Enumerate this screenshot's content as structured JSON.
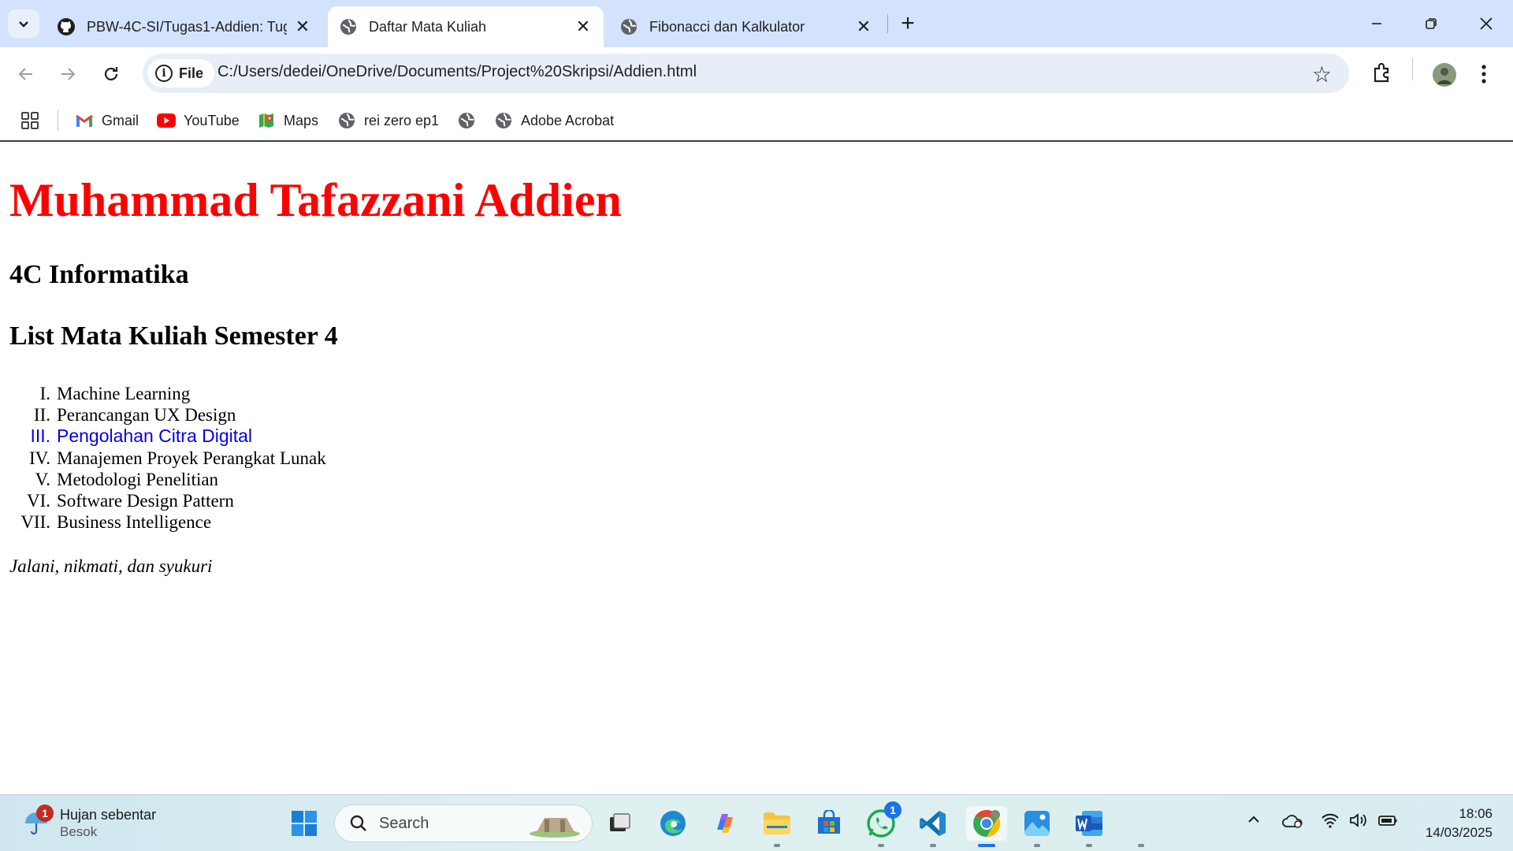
{
  "browser": {
    "tabs": [
      {
        "title": "PBW-4C-SI/Tugas1-Addien: Tug",
        "favicon": "github-icon",
        "active": false
      },
      {
        "title": "Daftar Mata Kuliah",
        "favicon": "globe-icon",
        "active": true
      },
      {
        "title": "Fibonacci dan Kalkulator",
        "favicon": "globe-icon",
        "active": false
      }
    ],
    "address": {
      "chip_label": "File",
      "url": "C:/Users/dedei/OneDrive/Documents/Project%20Skripsi/Addien.html"
    },
    "bookmarks": [
      {
        "label": "Gmail",
        "icon": "gmail-icon"
      },
      {
        "label": "YouTube",
        "icon": "youtube-icon"
      },
      {
        "label": "Maps",
        "icon": "maps-icon"
      },
      {
        "label": "rei zero ep1",
        "icon": "globe-icon"
      },
      {
        "label": "",
        "icon": "globe-icon"
      },
      {
        "label": "Adobe Acrobat",
        "icon": "globe-icon"
      }
    ]
  },
  "page": {
    "name": "Muhammad Tafazzani Addien",
    "class": "4C Informatika",
    "list_heading": "List Mata Kuliah Semester 4",
    "courses": [
      {
        "num": "I.",
        "name": "Machine Learning"
      },
      {
        "num": "II.",
        "name": "Perancangan UX Design"
      },
      {
        "num": "III.",
        "name": "Pengolahan Citra Digital"
      },
      {
        "num": "IV.",
        "name": "Manajemen Proyek Perangkat Lunak"
      },
      {
        "num": "V.",
        "name": "Metodologi Penelitian"
      },
      {
        "num": "VI.",
        "name": "Software Design Pattern"
      },
      {
        "num": "VII.",
        "name": "Business Intelligence"
      }
    ],
    "motto": "Jalani, nikmati, dan syukuri",
    "colors": {
      "name": "#ff0000",
      "highlight": "#0000ee"
    }
  },
  "taskbar": {
    "weather": {
      "line1": "Hujan sebentar",
      "line2": "Besok",
      "badge": "1"
    },
    "search_placeholder": "Search",
    "whatsapp_badge": "1",
    "time": "18:06",
    "date": "14/03/2025"
  }
}
